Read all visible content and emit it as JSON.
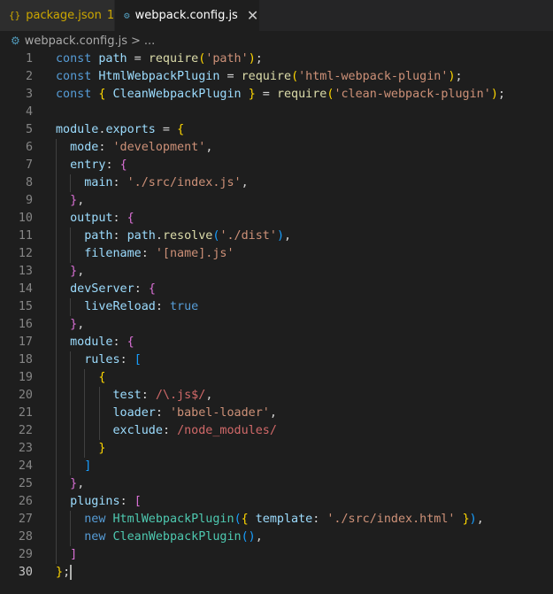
{
  "tabs": [
    {
      "icon": "{}",
      "label": "package.json",
      "badge": "1"
    },
    {
      "icon": "⚙",
      "label": "webpack.config.js",
      "close": "✕"
    }
  ],
  "breadcrumb": {
    "file": "webpack.config.js",
    "separator": ">",
    "more": "..."
  },
  "editor": {
    "current_line": 30,
    "lines": [
      {
        "n": "1",
        "tokens": [
          {
            "t": "const ",
            "c": "kw"
          },
          {
            "t": "path",
            "c": "var"
          },
          {
            "t": " = ",
            "c": "op"
          },
          {
            "t": "require",
            "c": "fn"
          },
          {
            "t": "(",
            "c": "b1"
          },
          {
            "t": "'path'",
            "c": "str"
          },
          {
            "t": ")",
            "c": "b1"
          },
          {
            "t": ";",
            "c": "op"
          }
        ]
      },
      {
        "n": "2",
        "tokens": [
          {
            "t": "const ",
            "c": "kw"
          },
          {
            "t": "HtmlWebpackPlugin",
            "c": "var"
          },
          {
            "t": " = ",
            "c": "op"
          },
          {
            "t": "require",
            "c": "fn"
          },
          {
            "t": "(",
            "c": "b1"
          },
          {
            "t": "'html-webpack-plugin'",
            "c": "str"
          },
          {
            "t": ")",
            "c": "b1"
          },
          {
            "t": ";",
            "c": "op"
          }
        ]
      },
      {
        "n": "3",
        "tokens": [
          {
            "t": "const ",
            "c": "kw"
          },
          {
            "t": "{",
            "c": "b1"
          },
          {
            "t": " CleanWebpackPlugin ",
            "c": "var"
          },
          {
            "t": "}",
            "c": "b1"
          },
          {
            "t": " = ",
            "c": "op"
          },
          {
            "t": "require",
            "c": "fn"
          },
          {
            "t": "(",
            "c": "b1"
          },
          {
            "t": "'clean-webpack-plugin'",
            "c": "str"
          },
          {
            "t": ")",
            "c": "b1"
          },
          {
            "t": ";",
            "c": "op"
          }
        ]
      },
      {
        "n": "4",
        "tokens": []
      },
      {
        "n": "5",
        "tokens": [
          {
            "t": "module",
            "c": "var"
          },
          {
            "t": ".",
            "c": "op"
          },
          {
            "t": "exports",
            "c": "var"
          },
          {
            "t": " = ",
            "c": "op"
          },
          {
            "t": "{",
            "c": "b1"
          }
        ]
      },
      {
        "n": "6",
        "indent": 1,
        "tokens": [
          {
            "t": "mode",
            "c": "var"
          },
          {
            "t": ": ",
            "c": "op"
          },
          {
            "t": "'development'",
            "c": "str"
          },
          {
            "t": ",",
            "c": "op"
          }
        ]
      },
      {
        "n": "7",
        "indent": 1,
        "tokens": [
          {
            "t": "entry",
            "c": "var"
          },
          {
            "t": ": ",
            "c": "op"
          },
          {
            "t": "{",
            "c": "b2"
          }
        ]
      },
      {
        "n": "8",
        "indent": 2,
        "tokens": [
          {
            "t": "main",
            "c": "var"
          },
          {
            "t": ": ",
            "c": "op"
          },
          {
            "t": "'./src/index.js'",
            "c": "str"
          },
          {
            "t": ",",
            "c": "op"
          }
        ]
      },
      {
        "n": "9",
        "indent": 1,
        "tokens": [
          {
            "t": "}",
            "c": "b2"
          },
          {
            "t": ",",
            "c": "op"
          }
        ]
      },
      {
        "n": "10",
        "indent": 1,
        "tokens": [
          {
            "t": "output",
            "c": "var"
          },
          {
            "t": ": ",
            "c": "op"
          },
          {
            "t": "{",
            "c": "b2"
          }
        ]
      },
      {
        "n": "11",
        "indent": 2,
        "tokens": [
          {
            "t": "path",
            "c": "var"
          },
          {
            "t": ": ",
            "c": "op"
          },
          {
            "t": "path",
            "c": "var"
          },
          {
            "t": ".",
            "c": "op"
          },
          {
            "t": "resolve",
            "c": "fn"
          },
          {
            "t": "(",
            "c": "b3"
          },
          {
            "t": "'./dist'",
            "c": "str"
          },
          {
            "t": ")",
            "c": "b3"
          },
          {
            "t": ",",
            "c": "op"
          }
        ]
      },
      {
        "n": "12",
        "indent": 2,
        "tokens": [
          {
            "t": "filename",
            "c": "var"
          },
          {
            "t": ": ",
            "c": "op"
          },
          {
            "t": "'[name].js'",
            "c": "str"
          }
        ]
      },
      {
        "n": "13",
        "indent": 1,
        "tokens": [
          {
            "t": "}",
            "c": "b2"
          },
          {
            "t": ",",
            "c": "op"
          }
        ]
      },
      {
        "n": "14",
        "indent": 1,
        "tokens": [
          {
            "t": "devServer",
            "c": "var"
          },
          {
            "t": ": ",
            "c": "op"
          },
          {
            "t": "{",
            "c": "b2"
          }
        ]
      },
      {
        "n": "15",
        "indent": 2,
        "tokens": [
          {
            "t": "liveReload",
            "c": "var"
          },
          {
            "t": ": ",
            "c": "op"
          },
          {
            "t": "true",
            "c": "kw"
          }
        ]
      },
      {
        "n": "16",
        "indent": 1,
        "tokens": [
          {
            "t": "}",
            "c": "b2"
          },
          {
            "t": ",",
            "c": "op"
          }
        ]
      },
      {
        "n": "17",
        "indent": 1,
        "tokens": [
          {
            "t": "module",
            "c": "var"
          },
          {
            "t": ": ",
            "c": "op"
          },
          {
            "t": "{",
            "c": "b2"
          }
        ]
      },
      {
        "n": "18",
        "indent": 2,
        "tokens": [
          {
            "t": "rules",
            "c": "var"
          },
          {
            "t": ": ",
            "c": "op"
          },
          {
            "t": "[",
            "c": "b3"
          }
        ]
      },
      {
        "n": "19",
        "indent": 3,
        "tokens": [
          {
            "t": "{",
            "c": "b1"
          }
        ]
      },
      {
        "n": "20",
        "indent": 4,
        "tokens": [
          {
            "t": "test",
            "c": "var"
          },
          {
            "t": ": ",
            "c": "op"
          },
          {
            "t": "/\\.js$/",
            "c": "rx"
          },
          {
            "t": ",",
            "c": "op"
          }
        ]
      },
      {
        "n": "21",
        "indent": 4,
        "tokens": [
          {
            "t": "loader",
            "c": "var"
          },
          {
            "t": ": ",
            "c": "op"
          },
          {
            "t": "'babel-loader'",
            "c": "str"
          },
          {
            "t": ",",
            "c": "op"
          }
        ]
      },
      {
        "n": "22",
        "indent": 4,
        "tokens": [
          {
            "t": "exclude",
            "c": "var"
          },
          {
            "t": ": ",
            "c": "op"
          },
          {
            "t": "/node_modules/",
            "c": "rx"
          }
        ]
      },
      {
        "n": "23",
        "indent": 3,
        "tokens": [
          {
            "t": "}",
            "c": "b1"
          }
        ]
      },
      {
        "n": "24",
        "indent": 2,
        "tokens": [
          {
            "t": "]",
            "c": "b3"
          }
        ]
      },
      {
        "n": "25",
        "indent": 1,
        "tokens": [
          {
            "t": "}",
            "c": "b2"
          },
          {
            "t": ",",
            "c": "op"
          }
        ]
      },
      {
        "n": "26",
        "indent": 1,
        "tokens": [
          {
            "t": "plugins",
            "c": "var"
          },
          {
            "t": ": ",
            "c": "op"
          },
          {
            "t": "[",
            "c": "b2"
          }
        ]
      },
      {
        "n": "27",
        "indent": 2,
        "tokens": [
          {
            "t": "new ",
            "c": "kw"
          },
          {
            "t": "HtmlWebpackPlugin",
            "c": "cls"
          },
          {
            "t": "(",
            "c": "b3"
          },
          {
            "t": "{",
            "c": "b1"
          },
          {
            "t": " ",
            "c": "op"
          },
          {
            "t": "template",
            "c": "var"
          },
          {
            "t": ": ",
            "c": "op"
          },
          {
            "t": "'./src/index.html'",
            "c": "str"
          },
          {
            "t": " ",
            "c": "op"
          },
          {
            "t": "}",
            "c": "b1"
          },
          {
            "t": ")",
            "c": "b3"
          },
          {
            "t": ",",
            "c": "op"
          }
        ]
      },
      {
        "n": "28",
        "indent": 2,
        "tokens": [
          {
            "t": "new ",
            "c": "kw"
          },
          {
            "t": "CleanWebpackPlugin",
            "c": "cls"
          },
          {
            "t": "()",
            "c": "b3"
          },
          {
            "t": ",",
            "c": "op"
          }
        ]
      },
      {
        "n": "29",
        "indent": 1,
        "tokens": [
          {
            "t": "]",
            "c": "b2"
          }
        ]
      },
      {
        "n": "30",
        "tokens": [
          {
            "t": "}",
            "c": "b1"
          },
          {
            "t": ";",
            "c": "op"
          }
        ],
        "cursor": true
      }
    ]
  }
}
